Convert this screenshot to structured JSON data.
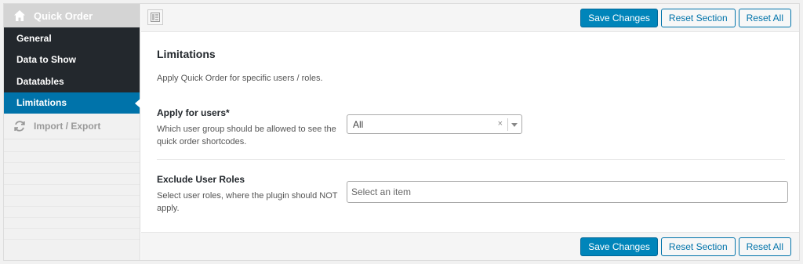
{
  "sidebar": {
    "brand": {
      "label": "Quick Order",
      "icon": "home-icon"
    },
    "items": [
      {
        "label": "General",
        "active": false
      },
      {
        "label": "Data to Show",
        "active": false
      },
      {
        "label": "Datatables",
        "active": false
      },
      {
        "label": "Limitations",
        "active": true
      }
    ],
    "import_export": {
      "label": "Import / Export",
      "icon": "sync-icon"
    }
  },
  "toolbar": {
    "save_label": "Save Changes",
    "reset_section_label": "Reset Section",
    "reset_all_label": "Reset All",
    "layout_toggle_icon": "layout-toggle-icon"
  },
  "section": {
    "title": "Limitations",
    "description": "Apply Quick Order for specific users / roles."
  },
  "fields": {
    "apply_users": {
      "label": "Apply for users*",
      "description": "Which user group should be allowed to see the quick order shortcodes.",
      "value": "All",
      "clear": "×"
    },
    "exclude_roles": {
      "label": "Exclude User Roles",
      "description": "Select user roles, where the plugin should NOT apply.",
      "placeholder": "Select an item"
    }
  },
  "colors": {
    "accent": "#0073aa",
    "primary_button": "#0085ba",
    "sidebar_dark": "#23282d"
  }
}
